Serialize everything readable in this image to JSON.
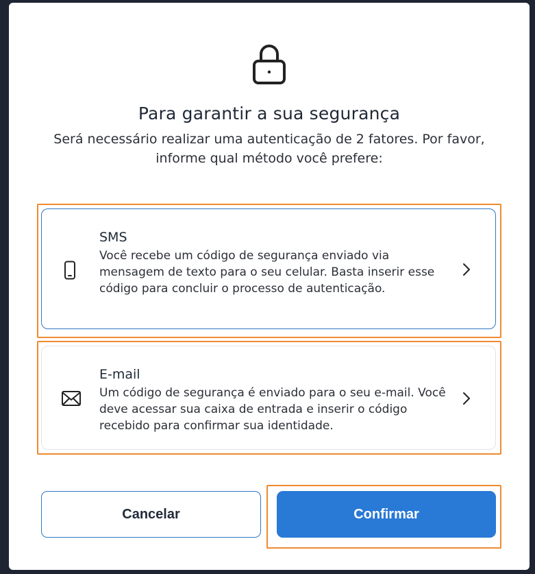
{
  "header": {
    "icon": "lock-icon",
    "title": "Para garantir a sua segurança",
    "subtitle": "Será necessário realizar uma autenticação de 2 fatores. Por favor, informe qual método você prefere:"
  },
  "options": [
    {
      "id": "sms",
      "icon": "smartphone-icon",
      "title": "SMS",
      "description": "Você recebe um código de segurança enviado via mensagem de texto para o seu celular. Basta inserir esse código para concluir o processo de autenticação."
    },
    {
      "id": "email",
      "icon": "envelope-icon",
      "title": "E-mail",
      "description": "Um código de segurança é enviado para o seu e-mail. Você deve acessar sua caixa de entrada e inserir o código recebido para confirmar sua identidade."
    }
  ],
  "actions": {
    "cancel_label": "Cancelar",
    "confirm_label": "Confirmar"
  },
  "colors": {
    "primary": "#2979d6",
    "highlight": "#f08a2e",
    "selected_border": "#2f78c4"
  }
}
